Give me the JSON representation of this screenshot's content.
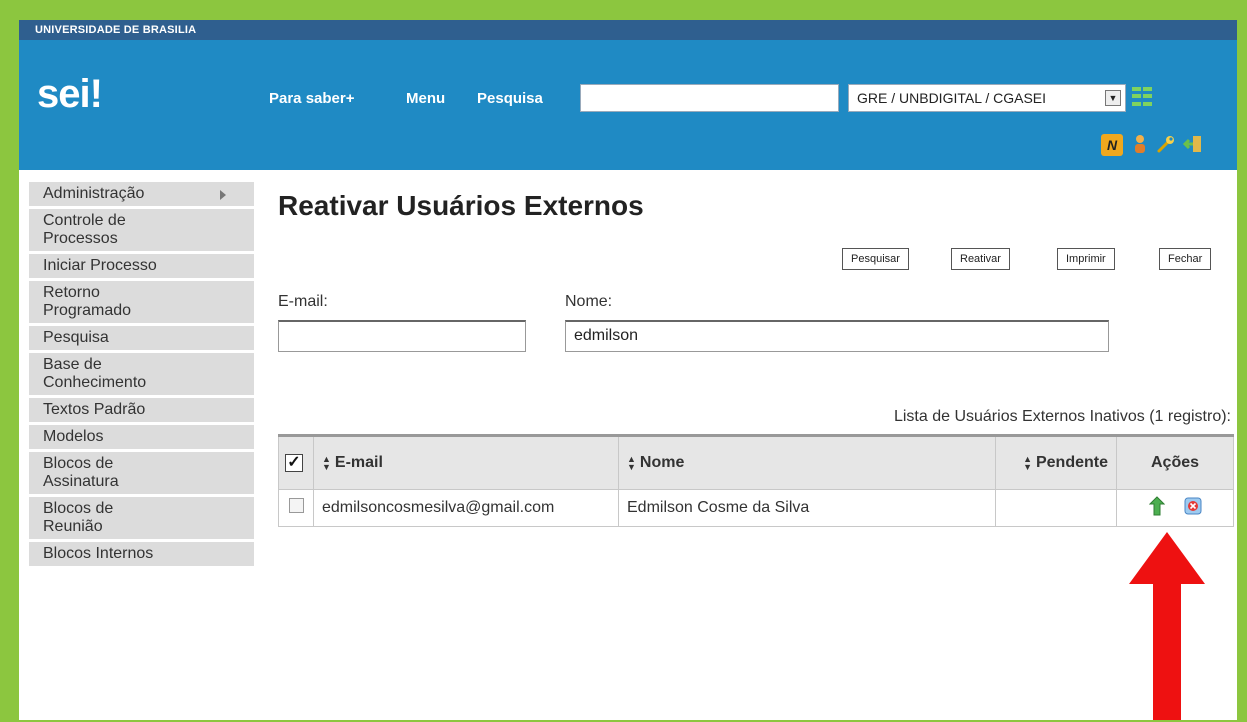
{
  "header": {
    "org_name": "UNIVERSIDADE DE BRASILIA",
    "logo": "sei!",
    "nav": {
      "para_saber": "Para saber+",
      "menu": "Menu",
      "pesquisa": "Pesquisa"
    },
    "search_value": "",
    "unit_selected": "GRE / UNBDIGITAL / CGASEI",
    "icons": [
      "grid-icon",
      "n-icon",
      "user-icon",
      "wrench-icon",
      "exit-icon"
    ]
  },
  "sidebar": {
    "items": [
      {
        "label": "Administração"
      },
      {
        "label": "Controle de Processos"
      },
      {
        "label": "Iniciar Processo"
      },
      {
        "label": "Retorno Programado"
      },
      {
        "label": "Pesquisa"
      },
      {
        "label": "Base de Conhecimento"
      },
      {
        "label": "Textos Padrão"
      },
      {
        "label": "Modelos"
      },
      {
        "label": "Blocos de Assinatura"
      },
      {
        "label": "Blocos de Reunião"
      },
      {
        "label": "Blocos Internos"
      }
    ]
  },
  "main": {
    "title": "Reativar Usuários Externos",
    "buttons": {
      "pesquisar": "Pesquisar",
      "reativar": "Reativar",
      "imprimir": "Imprimir",
      "fechar": "Fechar"
    },
    "form": {
      "email_label": "E-mail:",
      "email_value": "",
      "nome_label": "Nome:",
      "nome_value": "edmilson"
    },
    "list_caption": "Lista de Usuários Externos Inativos (1 registro):",
    "table": {
      "columns": {
        "email": "E-mail",
        "nome": "Nome",
        "pendente": "Pendente",
        "acoes": "Ações"
      },
      "rows": [
        {
          "email": "edmilsoncosmesilva@gmail.com",
          "nome": "Edmilson Cosme da Silva",
          "pendente": ""
        }
      ]
    },
    "annotation_arrow_color": "#ee1111"
  }
}
